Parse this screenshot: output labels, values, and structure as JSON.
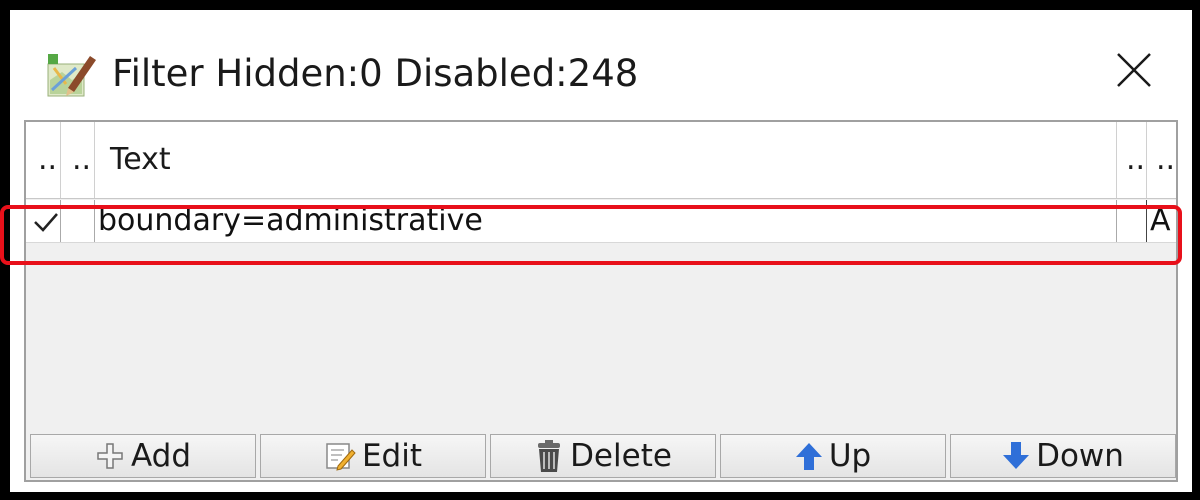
{
  "window": {
    "title": "Filter Hidden:0 Disabled:248",
    "close_glyph": "✕",
    "app_icon": "josm-app-icon"
  },
  "table": {
    "headers": [
      "..",
      "..",
      "Text",
      "..",
      ".."
    ],
    "rows": [
      {
        "enabled": "✓",
        "hidden": "",
        "text": "boundary=administrative",
        "inverted": "",
        "mode": "A"
      }
    ]
  },
  "buttons": {
    "add": {
      "label": "Add",
      "icon": "plus-icon"
    },
    "edit": {
      "label": "Edit",
      "icon": "pencil-note-icon"
    },
    "delete": {
      "label": "Delete",
      "icon": "trash-icon"
    },
    "up": {
      "label": "Up",
      "icon": "arrow-up-icon"
    },
    "down": {
      "label": "Down",
      "icon": "arrow-down-icon"
    }
  },
  "colors": {
    "highlight": "#e8101a",
    "arrow_blue": "#2f6fd8"
  }
}
